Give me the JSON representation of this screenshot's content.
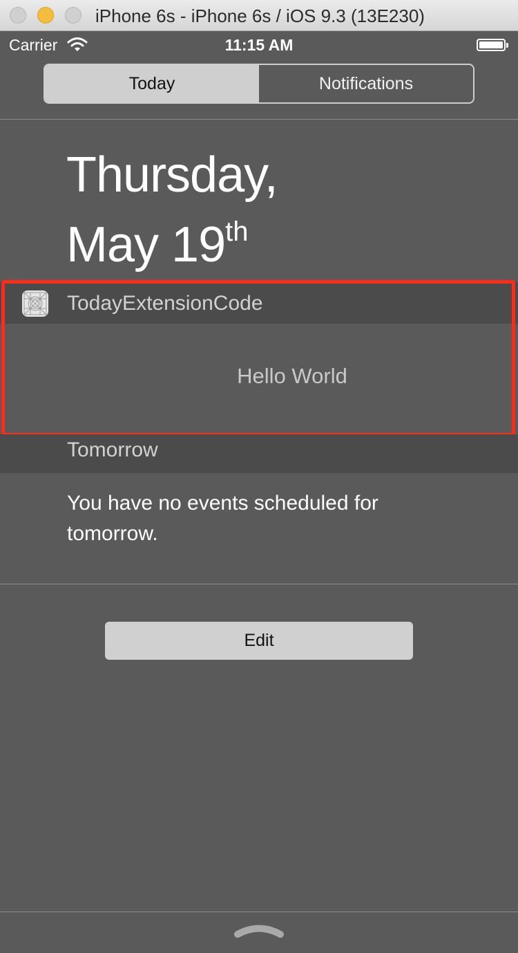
{
  "window": {
    "title": "iPhone 6s - iPhone 6s / iOS 9.3 (13E230)"
  },
  "status_bar": {
    "carrier": "Carrier",
    "time": "11:15 AM",
    "battery_level": 1.0
  },
  "segmented_control": {
    "segments": [
      {
        "label": "Today",
        "selected": true
      },
      {
        "label": "Notifications",
        "selected": false
      }
    ]
  },
  "date": {
    "line1": "Thursday,",
    "line2": "May 19",
    "suffix": "th"
  },
  "widget": {
    "icon": "app-placeholder-icon",
    "title": "TodayExtensionCode",
    "content": "Hello World",
    "highlight_color": "#ff2a17"
  },
  "tomorrow": {
    "title": "Tomorrow",
    "message": "You have no events scheduled for tomorrow."
  },
  "edit_button": {
    "label": "Edit"
  }
}
